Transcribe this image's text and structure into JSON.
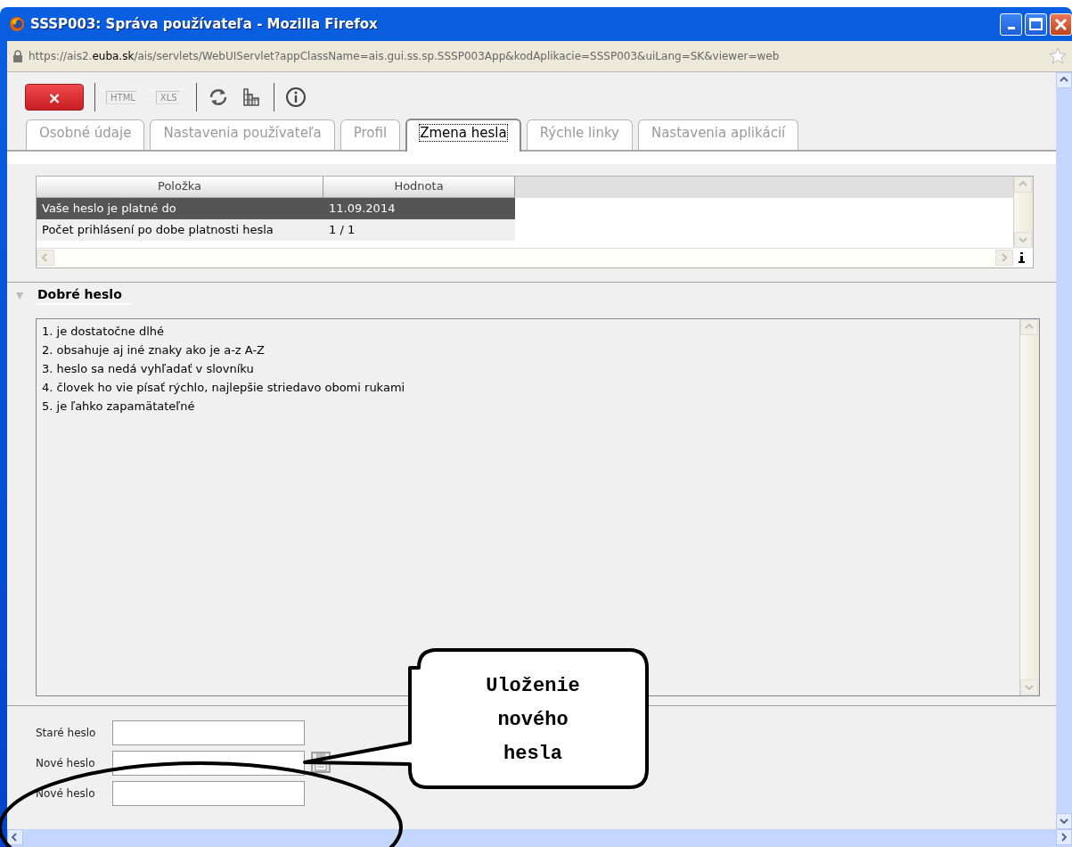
{
  "window": {
    "title": "SSSP003: Správa používateľa - Mozilla Firefox"
  },
  "address_bar": {
    "url": "https://ais2.**euba.sk**/ais/servlets/WebUIServlet?appClassName=ais.gui.ss.sp.SSSP003App&kodAplikacie=SSSP003&uiLang=SK&viewer=web"
  },
  "toolbar": [
    [
      {
        "kind": "close",
        "label": "×",
        "disabled": false
      }
    ],
    [
      {
        "kind": "export",
        "label": "HTML",
        "disabled": true
      },
      {
        "kind": "export",
        "label": "XLS",
        "disabled": true
      }
    ],
    [
      {
        "kind": "refresh",
        "disabled": false
      },
      {
        "kind": "grid",
        "disabled": false
      }
    ],
    [
      {
        "kind": "info",
        "disabled": false
      }
    ]
  ],
  "tabs": [
    {
      "label": "Osobné údaje",
      "selected": false
    },
    {
      "label": "Nastavenia používateľa",
      "selected": false
    },
    {
      "label": "Profil",
      "selected": false
    },
    {
      "label": "Zmena hesla",
      "selected": true
    },
    {
      "label": "Rýchle linky",
      "selected": false
    },
    {
      "label": "Nastavenia aplikácií",
      "selected": false
    }
  ],
  "table": {
    "columns": [
      "Položka",
      "Hodnota"
    ],
    "rows": [
      {
        "cells": [
          "Vaše heslo je platné do",
          "11.09.2014"
        ],
        "selected": true
      },
      {
        "cells": [
          "Počet prihlásení po dobe platnosti hesla",
          "1 / 1"
        ],
        "selected": false
      }
    ]
  },
  "section": {
    "title": "Dobré heslo",
    "expanded": true,
    "lines": [
      "1. je dostatočne dlhé",
      "2. obsahuje aj iné znaky ako je a-z A-Z",
      "3. heslo sa nedá vyhľadať v slovníku",
      "4. človek ho vie písať rýchlo, najlepšie striedavo obomi rukami",
      "5. je ľahko zapamätateľné"
    ]
  },
  "form": [
    {
      "label": "Staré heslo",
      "save": false
    },
    {
      "label": "Nové heslo",
      "save": true
    },
    {
      "label": "Nové heslo",
      "save": false
    }
  ],
  "callout": {
    "text": "Uloženie nového hesla"
  }
}
